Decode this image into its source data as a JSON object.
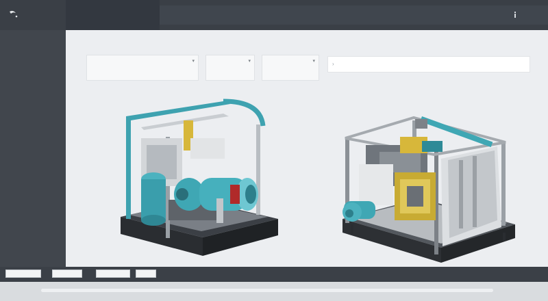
{
  "topbar": {
    "logo_icon": "crescent-logo",
    "title": "",
    "right_items": [
      "",
      "",
      ""
    ]
  },
  "sidebar": {
    "items": [
      {
        "label": ""
      },
      {
        "label": ""
      },
      {
        "label": ""
      },
      {
        "label": ""
      },
      {
        "label": ""
      },
      {
        "label": ""
      }
    ]
  },
  "main": {
    "title": "",
    "title_right": "",
    "fields": [
      {
        "label": "",
        "placeholder": "",
        "icon": "chevron-down-icon"
      },
      {
        "label": "",
        "placeholder": "",
        "icon": "chevron-down-icon"
      },
      {
        "label": "",
        "placeholder": "",
        "icon": "chevron-down-icon"
      }
    ],
    "wide_field": {
      "label": "",
      "placeholder": "",
      "icon": "chevron-icon"
    },
    "models": [
      {
        "name": "pump-skid-model",
        "accent": "#3fa7b4"
      },
      {
        "name": "processing-unit-model",
        "accent": "#d7b73a"
      }
    ]
  },
  "bottombar": {
    "buttons": [
      {
        "label": ""
      },
      {
        "label": ""
      },
      {
        "label": ""
      },
      {
        "label": ""
      }
    ]
  },
  "colors": {
    "topbar": "#3a3f46",
    "sidebar": "#41464d",
    "main_bg": "#eceef1",
    "teal": "#3fa7b4",
    "yellow": "#d7b73a"
  }
}
